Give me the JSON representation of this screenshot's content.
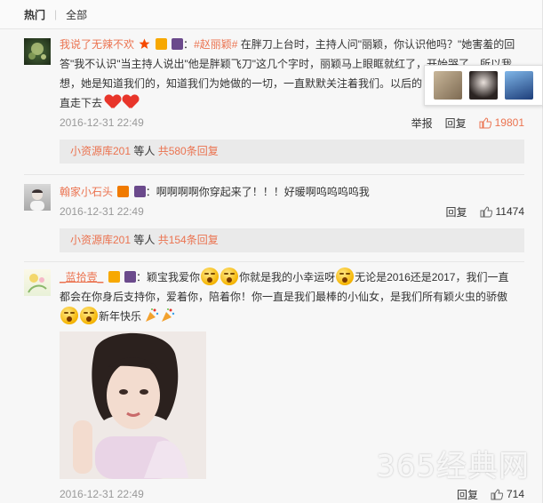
{
  "tabs": [
    {
      "label": "热门",
      "active": true
    },
    {
      "label": "全部",
      "active": false
    }
  ],
  "comments": [
    {
      "username": "我说了无辣不欢",
      "hashtag": "#赵丽颖#",
      "text1": " 在胖刀上台时，主持人问\"丽颖，你认识他吗？\"她害羞的回",
      "text2": "答\"我不认识\"当主持人说出\"他是胖颖飞刀\"这几个字时，丽颖马上眼眶就红了，开始哭了，所以我",
      "text3": "想，她是知道我们的，知道我们为她做的一切，一直默默关注着我们。以后的",
      "text4": "直走下去",
      "time": "2016-12-31 22:49",
      "report": "举报",
      "reply": "回复",
      "likes": "19801",
      "reply_user": "小资源库201",
      "reply_mid": " 等人 ",
      "reply_count": "共580条回复"
    },
    {
      "username": "翰家小石头",
      "text": "：啊啊啊啊你穿起来了！！！好暖啊呜呜呜呜我",
      "time": "2016-12-31 22:49",
      "reply": "回复",
      "likes": "11474",
      "reply_user": "小资源库201",
      "reply_mid": " 等人 ",
      "reply_count": "共154条回复"
    },
    {
      "username": "_蓝拾壹_",
      "text1a": "：颖宝我爱你",
      "text1b": "你就是我的小幸运呀",
      "text1c": "无论是2016还是2017，我们一直",
      "text2": "都会在你身后支持你，爱着你，陪着你！你一直是我们最棒的小仙女，是我们所有颖火虫的骄傲",
      "text3": "新年快乐",
      "time": "2016-12-31 22:49",
      "reply": "回复",
      "likes": "714"
    }
  ],
  "watermark": "365经典网",
  "colors": {
    "accent": "#eb7350",
    "link": "#eb7350"
  }
}
